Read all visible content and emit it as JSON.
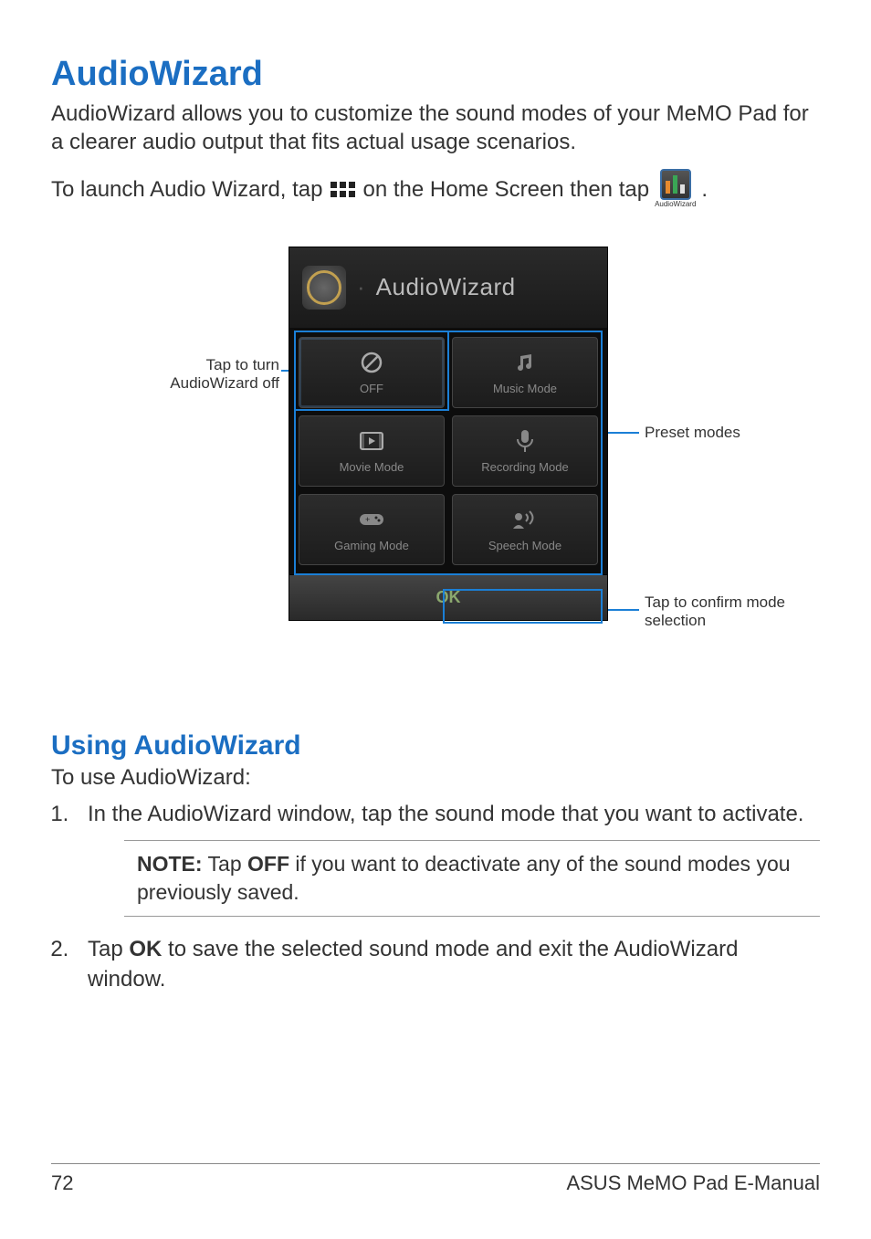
{
  "page": {
    "number": "72",
    "footer": "ASUS MeMO Pad E-Manual"
  },
  "title": "AudioWizard",
  "intro": "AudioWizard allows you to customize the sound modes of your MeMO Pad for a clearer audio output that fits actual usage scenarios.",
  "launch": {
    "pre": "To launch Audio Wizard, tap",
    "mid": "on the Home Screen then tap",
    "post": ".",
    "app_caption": "AudioWizard"
  },
  "screenshot": {
    "header_title": "AudioWizard",
    "modes": {
      "off": "OFF",
      "music": "Music Mode",
      "movie": "Movie Mode",
      "recording": "Recording Mode",
      "gaming": "Gaming Mode",
      "speech": "Speech Mode"
    },
    "ok": "OK"
  },
  "callouts": {
    "off": "Tap to turn AudioWizard off",
    "preset": "Preset modes",
    "confirm": "Tap to confirm mode selection"
  },
  "using": {
    "heading": "Using AudioWizard",
    "intro": "To use AudioWizard:",
    "step1": "In the AudioWizard window, tap the sound mode that you want to activate.",
    "note_label": "NOTE:",
    "note_body": "Tap OFF if you want to deactivate any of the sound modes you previously saved.",
    "note_pre": " Tap ",
    "note_bold": "OFF",
    "note_post": " if you want to deactivate any of the sound modes you previously saved.",
    "step2_pre": "Tap ",
    "step2_bold": "OK",
    "step2_post": " to save the selected sound mode and exit the AudioWizard window."
  }
}
